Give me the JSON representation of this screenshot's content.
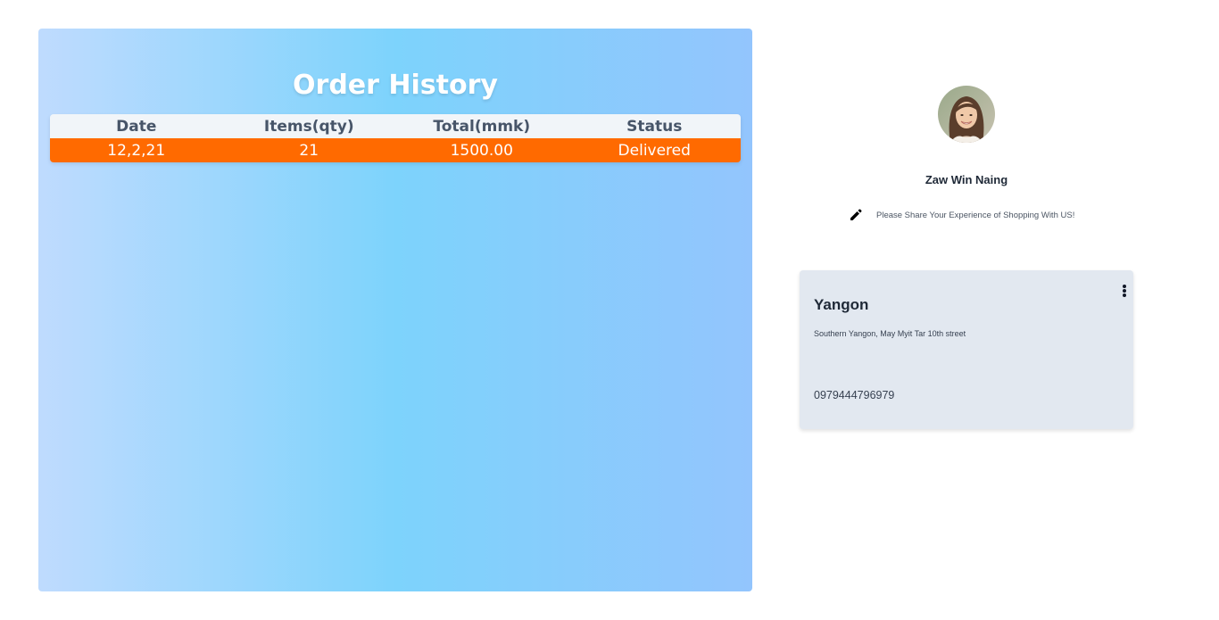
{
  "order_history": {
    "title": "Order History",
    "columns": [
      "Date",
      "Items(qty)",
      "Total(mmk)",
      "Status"
    ],
    "rows": [
      [
        "12,2,21",
        "21",
        "1500.00",
        "Delivered"
      ]
    ],
    "header_color": "#f1f5f9",
    "row_color": "#ff6a00"
  },
  "profile": {
    "avatar_icon": "user-avatar",
    "name": "Zaw Win Naing",
    "feedback_icon": "pencil-icon",
    "feedback_text": "Please Share Your Experience of Shopping With US!"
  },
  "address_card": {
    "menu_icon": "more-vertical-icon",
    "city": "Yangon",
    "address": "Southern Yangon, May Myit Tar 10th street",
    "phone": "0979444796979"
  }
}
